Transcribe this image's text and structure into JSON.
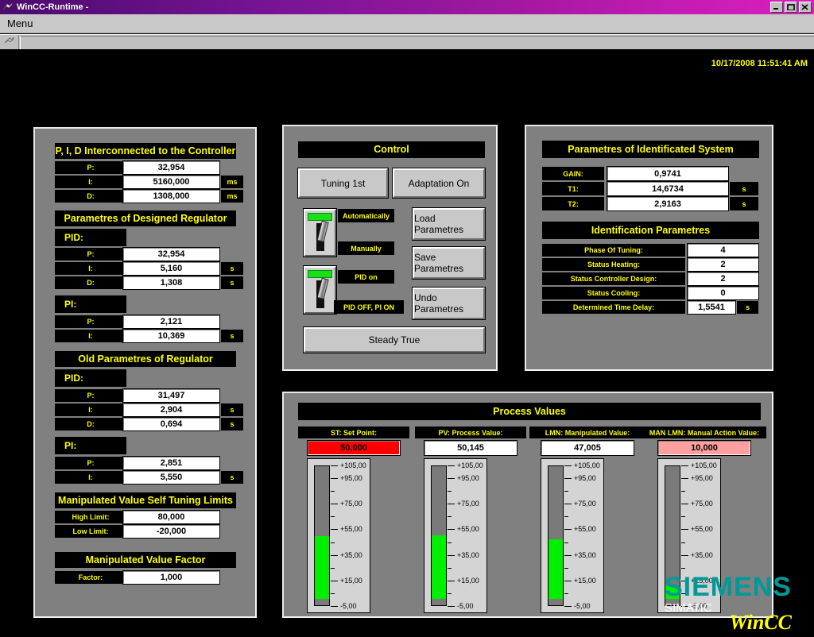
{
  "window": {
    "title": "WinCC-Runtime -",
    "icon": "wincc-icon",
    "minimize_label": "_",
    "maximize_label": "□",
    "close_label": "×"
  },
  "menubar": {
    "items": [
      {
        "label": "Menu"
      }
    ]
  },
  "toolbar": {
    "buttons": [
      {
        "icon": "cursor-arrow-icon"
      }
    ]
  },
  "runtime": {
    "timestamp": "10/17/2008 11:51:41 AM"
  },
  "left_panel": {
    "interconnected": {
      "caption": "P, I, D Interconnected to the Controller",
      "rows": [
        {
          "label": "P:",
          "value": "32,954",
          "unit": ""
        },
        {
          "label": "I:",
          "value": "5160,000",
          "unit": "ms"
        },
        {
          "label": "D:",
          "value": "1308,000",
          "unit": "ms"
        }
      ]
    },
    "designed": {
      "caption": "Parametres of Designed Regulator",
      "pid_label": "PID:",
      "pid_rows": [
        {
          "label": "P:",
          "value": "32,954",
          "unit": ""
        },
        {
          "label": "I:",
          "value": "5,160",
          "unit": "s"
        },
        {
          "label": "D:",
          "value": "1,308",
          "unit": "s"
        }
      ],
      "pi_label": "PI:",
      "pi_rows": [
        {
          "label": "P:",
          "value": "2,121",
          "unit": ""
        },
        {
          "label": "I:",
          "value": "10,369",
          "unit": "s"
        }
      ]
    },
    "old": {
      "caption": "Old Parametres of Regulator",
      "pid_label": "PID:",
      "pid_rows": [
        {
          "label": "P:",
          "value": "31,497",
          "unit": ""
        },
        {
          "label": "I:",
          "value": "2,904",
          "unit": "s"
        },
        {
          "label": "D:",
          "value": "0,694",
          "unit": "s"
        }
      ],
      "pi_label": "PI:",
      "pi_rows": [
        {
          "label": "P:",
          "value": "2,851",
          "unit": ""
        },
        {
          "label": "I:",
          "value": "5,550",
          "unit": "s"
        }
      ]
    },
    "limits": {
      "caption": "Manipulated Value Self Tuning Limits",
      "rows": [
        {
          "label": "High Limit:",
          "value": "80,000"
        },
        {
          "label": "Low Limit:",
          "value": "-20,000"
        }
      ]
    },
    "factor": {
      "caption": "Manipulated Value Factor",
      "rows": [
        {
          "label": "Factor:",
          "value": "1,000"
        }
      ]
    }
  },
  "control_panel": {
    "caption": "Control",
    "tuning_button": "Tuning 1st",
    "adaptation_button": "Adaptation On",
    "load_button": "Load Parametres",
    "save_button": "Save Parametres",
    "undo_button": "Undo Parametres",
    "steady_button": "Steady True",
    "mode_switch": {
      "top_label": "Automatically",
      "bottom_label": "Manually",
      "lamp_color": "#18e018"
    },
    "pid_switch": {
      "top_label": "PID on",
      "bottom_label": "PID OFF, PI ON",
      "lamp_color": "#18e018"
    }
  },
  "right_panel": {
    "identificated": {
      "caption": "Parametres of Identificated System",
      "rows": [
        {
          "label": "GAIN:",
          "value": "0,9741",
          "unit": ""
        },
        {
          "label": "T1:",
          "value": "14,6734",
          "unit": "s"
        },
        {
          "label": "T2:",
          "value": "2,9163",
          "unit": "s"
        }
      ]
    },
    "identification": {
      "caption": "Identification Parametres",
      "rows": [
        {
          "label": "Phase Of Tuning:",
          "value": "4",
          "unit": ""
        },
        {
          "label": "Status Heating:",
          "value": "2",
          "unit": ""
        },
        {
          "label": "Status Controller Design:",
          "value": "2",
          "unit": ""
        },
        {
          "label": "Status Cooling:",
          "value": "0",
          "unit": ""
        },
        {
          "label": "Determined Time Delay:",
          "value": "1,5541",
          "unit": "s"
        }
      ]
    }
  },
  "process_values": {
    "caption": "Process Values",
    "scale": {
      "min": -5,
      "max": 105,
      "major_ticks": [
        "+105,00",
        "+95,00",
        "+75,00",
        "+55,00",
        "+35,00",
        "+15,00",
        "-5,00"
      ],
      "major_values": [
        105,
        95,
        75,
        55,
        35,
        15,
        -5
      ],
      "minor_values": [
        85,
        65,
        45,
        25,
        5
      ]
    },
    "gauges": [
      {
        "label": "ST: Set Point:",
        "value": "50,000",
        "numeric": 50.0,
        "field_color": "#ff0000",
        "style": "red"
      },
      {
        "label": "PV: Process Value:",
        "value": "50,145",
        "numeric": 50.145,
        "field_color": "#ffffff",
        "style": "white"
      },
      {
        "label": "LMN: Manipulated Value:",
        "value": "47,005",
        "numeric": 47.005,
        "field_color": "#ffffff",
        "style": "white"
      },
      {
        "label": "MAN LMN: Manual Action Value:",
        "value": "10,000",
        "numeric": 10.0,
        "field_color": "#ff9f9f",
        "style": "pink"
      }
    ]
  },
  "logo": {
    "brand": "SIEMENS",
    "product_line": "SIMATIC",
    "product": "WinCC",
    "brand_color": "#009999",
    "product_color": "#ffff00"
  }
}
